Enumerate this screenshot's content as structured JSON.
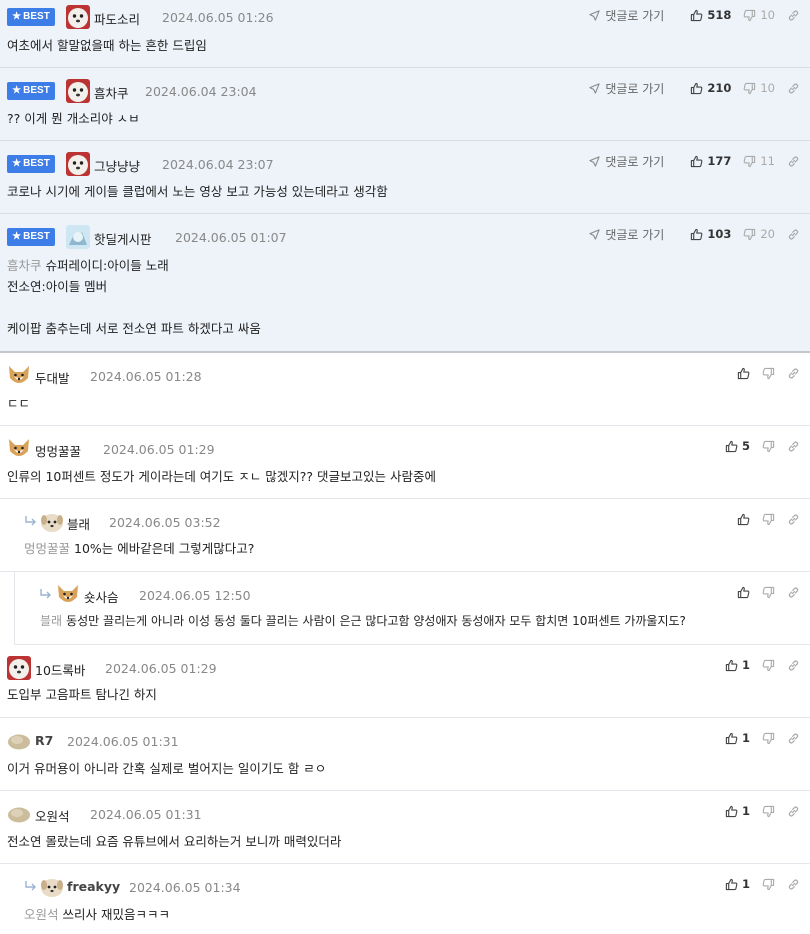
{
  "labels": {
    "best": "BEST",
    "goto": "댓글로 가기"
  },
  "best": [
    {
      "nick": "파도소리",
      "date": "2024.06.05 01:26",
      "up": "518",
      "down": "10",
      "lines": [
        "여초에서 할말없을때 하는 흔한 드립임"
      ]
    },
    {
      "nick": "흠차쿠",
      "date": "2024.06.04 23:04",
      "up": "210",
      "down": "10",
      "lines": [
        "?? 이게 뭔 개소리야 ㅅㅂ"
      ]
    },
    {
      "nick": "그냥냥냥",
      "date": "2024.06.04 23:07",
      "up": "177",
      "down": "11",
      "lines": [
        "코로나 시기에 게이들 클럽에서 노는 영상 보고 가능성 있는데라고 생각함"
      ]
    },
    {
      "nick": "핫딜게시판",
      "date": "2024.06.05 01:07",
      "up": "103",
      "down": "20",
      "mention": "흠차쿠",
      "lines": [
        "슈퍼레이디:아이들 노래",
        "전소연:아이들 멤버",
        "",
        "케이팝 춤추는데 서로 전소연 파트 하겠다고 싸움"
      ]
    }
  ],
  "comments": [
    {
      "nick": "두대발",
      "date": "2024.06.05 01:28",
      "up": "",
      "lines": [
        "ㄷㄷ"
      ]
    },
    {
      "nick": "멍멍꿀꿀",
      "date": "2024.06.05 01:29",
      "up": "5",
      "lines": [
        "인류의 10퍼센트 정도가 게이라는데 여기도 ㅈㄴ 많겠지?? 댓글보고있는 사람중에"
      ]
    },
    {
      "nick": "블래",
      "date": "2024.06.05 03:52",
      "up": "",
      "mention": "멍멍꿀꿀",
      "lines": [
        "10%는 에바같은데 그렇게많다고?"
      ]
    },
    {
      "nick": "숏사슴",
      "date": "2024.06.05 12:50",
      "up": "",
      "mention": "블래",
      "lines": [
        "동성만 끌리는게 아니라 이성 동성 둘다 끌리는 사람이 은근 많다고함 양성애자 동성애자 모두 합치면 10퍼센트 가까울지도?"
      ]
    },
    {
      "nick": "10드록바",
      "date": "2024.06.05 01:29",
      "up": "1",
      "lines": [
        "도입부 고음파트 탐나긴 하지"
      ]
    },
    {
      "nick": "R7",
      "date": "2024.06.05 01:31",
      "up": "1",
      "lines": [
        "이거 유머용이 아니라 간혹 실제로 벌어지는 일이기도 함 ㄹㅇ"
      ]
    },
    {
      "nick": "오원석",
      "date": "2024.06.05 01:31",
      "up": "1",
      "lines": [
        "전소연 몰랐는데 요즘 유튜브에서 요리하는거 보니까 매력있더라"
      ]
    },
    {
      "nick": "freakyy",
      "date": "2024.06.05 01:34",
      "up": "1",
      "mention": "오원석",
      "lines": [
        "쓰리사 재밌음ㅋㅋㅋ"
      ]
    }
  ],
  "colors": {
    "best_bg": "#eef3fa",
    "badge": "#3d7de8",
    "divider": "#e3e6ea"
  }
}
